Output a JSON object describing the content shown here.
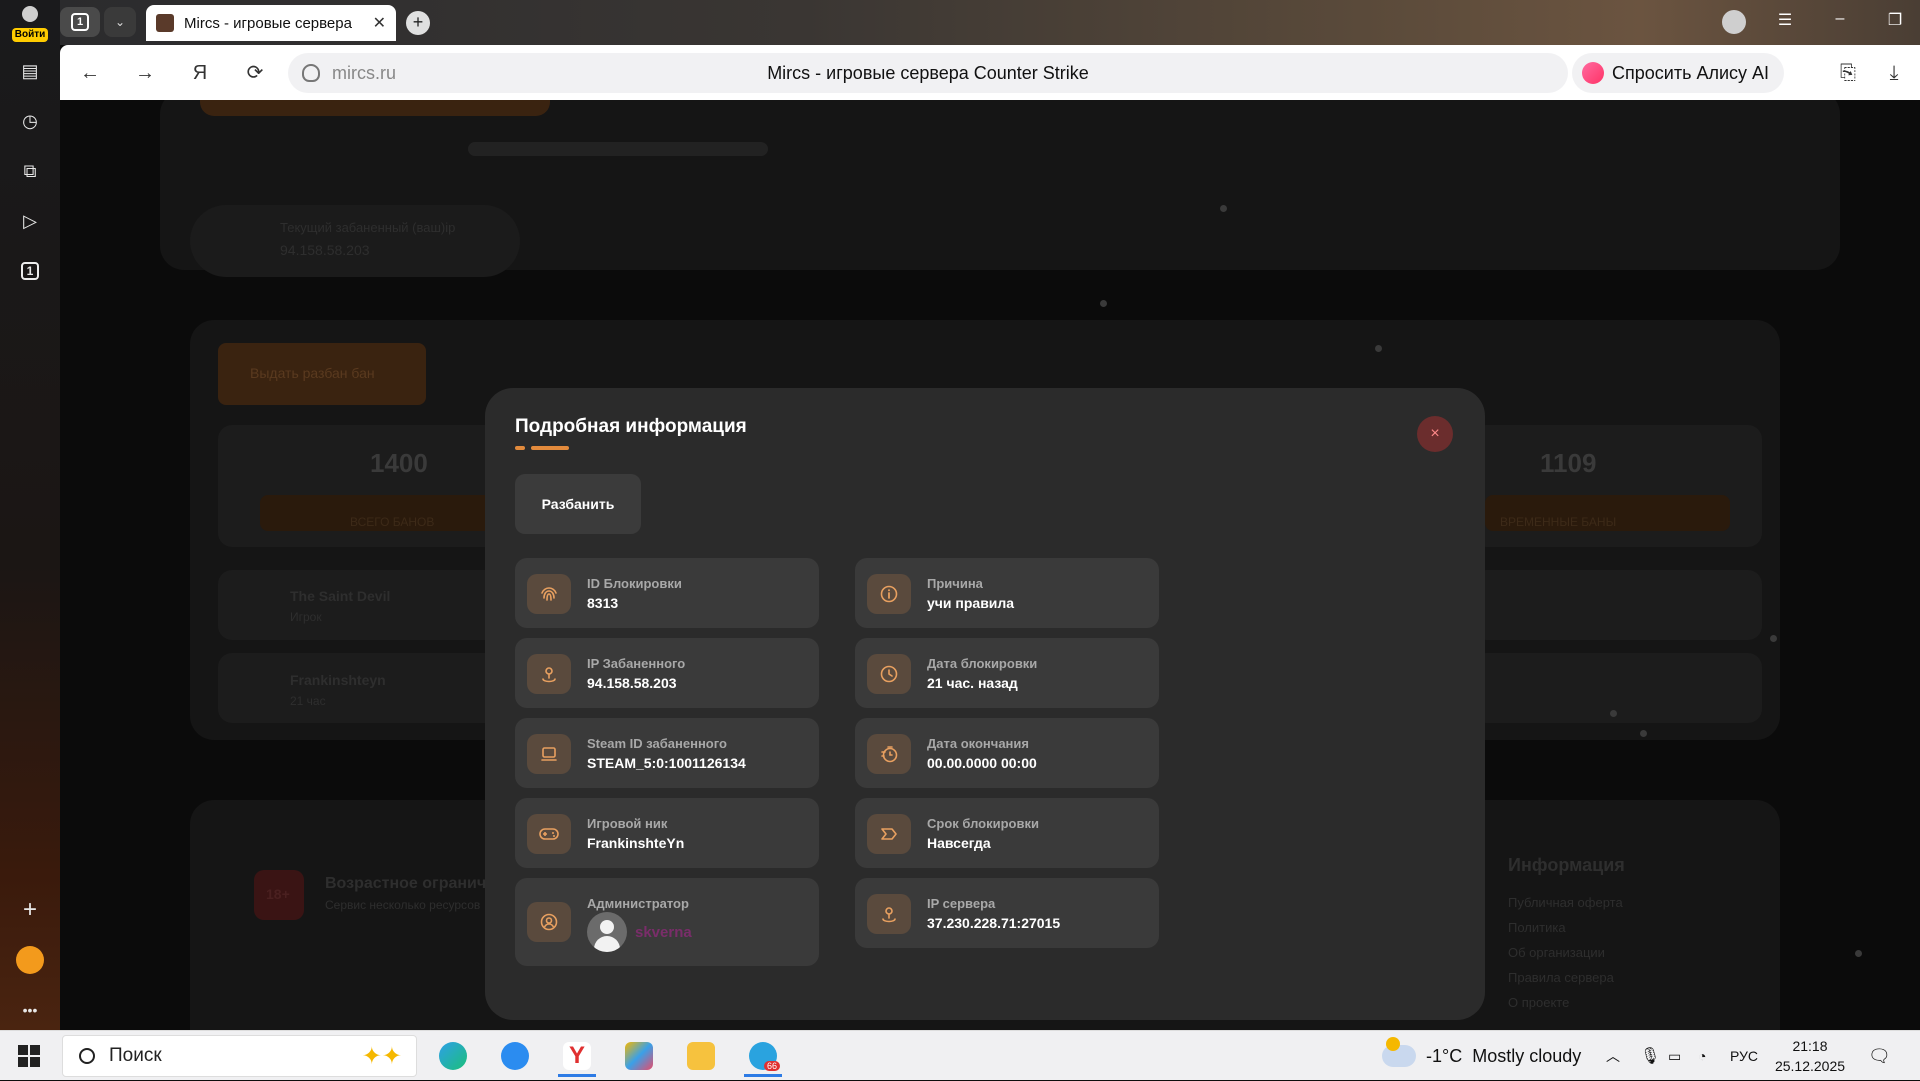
{
  "browser": {
    "login_label": "Войти",
    "tab_count": "1",
    "tab_title": "Mircs - игровые серверa",
    "new_tab": "+",
    "url_host": "mircs.ru",
    "page_title": "Mircs - игровые сервера Counter Strike",
    "alice_label": "Спросить Алису AI",
    "left_tab_count": "1"
  },
  "background": {
    "stat_left_value": "1400",
    "stat_left_label": "ВСЕГО БАНОВ",
    "stat_right_value": "1109",
    "stat_right_label": "ВРЕМЕННЫЕ БАНЫ",
    "ip_label": "Текущий забаненный (ваш)ip",
    "ip_value": "94.158.58.203",
    "button_label": "Выдать разбан бан",
    "row1_name": "The Saint Devil",
    "row1_sub": "Игрок",
    "row2_name": "Frankinshteyn",
    "row2_sub": "21 час",
    "age_title": "Возрастное ограничение",
    "age_sub": "Сервис несколько ресурсов",
    "age_badge": "18+",
    "info_title": "Информация",
    "info_items": [
      "Публичная оферта",
      "Политика",
      "Об организации",
      "Правила сервера",
      "О проекте"
    ]
  },
  "modal": {
    "title": "Подробная информация",
    "close": "×",
    "unban_label": "Разбанить",
    "left_cards": [
      {
        "label": "ID Блокировки",
        "value": "8313",
        "icon": "fingerprint-icon"
      },
      {
        "label": "IP Забаненного",
        "value": "94.158.58.203",
        "icon": "location-pin-icon"
      },
      {
        "label": "Steam ID забаненного",
        "value": "STEAM_5:0:1001126134",
        "icon": "laptop-icon"
      },
      {
        "label": "Игровой ник",
        "value": "FrankinshteYn",
        "icon": "gamepad-icon"
      }
    ],
    "admin": {
      "label": "Администратор",
      "name": "skverna",
      "icon": "user-circle-icon"
    },
    "right_cards": [
      {
        "label": "Причина",
        "value": "учи правила",
        "icon": "info-icon"
      },
      {
        "label": "Дата блокировки",
        "value": "21 час. назад",
        "icon": "clock-icon"
      },
      {
        "label": "Дата окончания",
        "value": "00.00.0000 00:00",
        "icon": "timer-icon"
      },
      {
        "label": "Срок блокировки",
        "value": "Навсегда",
        "icon": "tag-icon"
      },
      {
        "label": "IP сервера",
        "value": "37.230.228.71:27015",
        "icon": "location-pin-icon"
      }
    ]
  },
  "taskbar": {
    "search_placeholder": "Поиск",
    "weather_temp": "-1°C",
    "weather_text": "Mostly cloudy",
    "lang": "РУС",
    "time": "21:18",
    "date": "25.12.2025",
    "telegram_badge": "66"
  },
  "colors": {
    "accent": "#e28a3c",
    "modal_bg": "#2b2b2b",
    "card_bg": "#3a3a3a",
    "icon_bg": "#5a4a3d",
    "admin_name": "#7a2d6a"
  }
}
